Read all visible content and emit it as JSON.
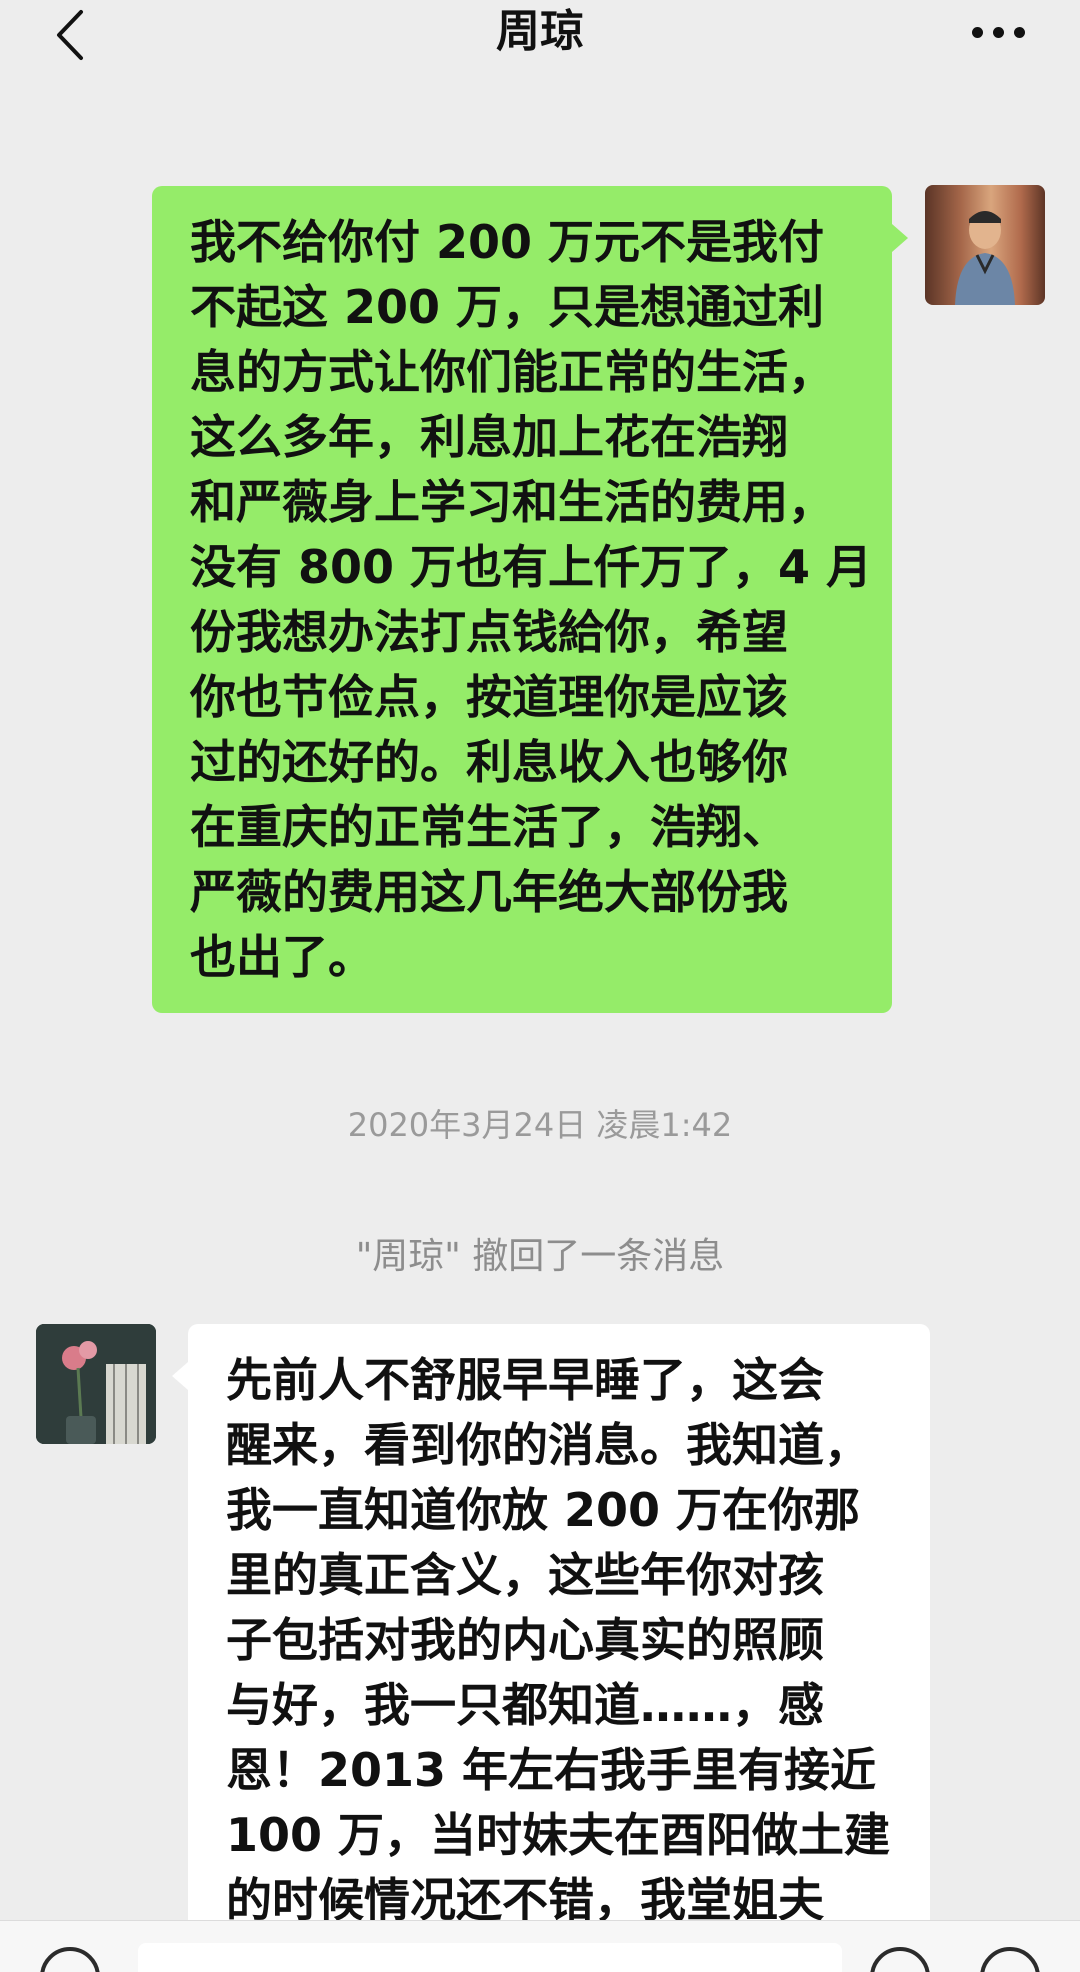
{
  "header": {
    "title": "周琼",
    "back_icon": "chevron-left-icon",
    "more_icon": "more-dots-icon",
    "faint_text": ""
  },
  "messages": [
    {
      "direction": "sent",
      "lines": [
        "我不给你付 200 万元不是我付",
        "不起这 200 万，只是想通过利",
        "息的方式让你们能正常的生活，",
        "这么多年，利息加上花在浩翔",
        "和严薇身上学习和生活的费用，",
        "没有 800 万也有上仟万了，4 月",
        "份我想办法打点钱給你，希望",
        "你也节俭点，按道理你是应该",
        "过的还好的。利息收入也够你",
        "在重庆的正常生活了，浩翔、",
        "严薇的费用这几年绝大部份我",
        "也出了。"
      ]
    },
    {
      "direction": "received",
      "lines": [
        "先前人不舒服早早睡了，这会",
        "醒来，看到你的消息。我知道，",
        "我一直知道你放 200 万在你那",
        "里的真正含义，这些年你对孩",
        "子包括对我的内心真实的照顾",
        "与好，我一只都知道……，感",
        "恩！2013 年左右我手里有接近",
        "100 万，当时妹夫在酉阳做土建",
        "的时候情况还不错，我堂姐夫"
      ]
    }
  ],
  "timestamp": "2020年3月24日 凌晨1:42",
  "recall_notice": "\"周琼\" 撤回了一条消息",
  "colors": {
    "background": "#ededed",
    "sent_bubble": "#95ec69",
    "received_bubble": "#ffffff",
    "system_text": "#9a9a9a"
  }
}
